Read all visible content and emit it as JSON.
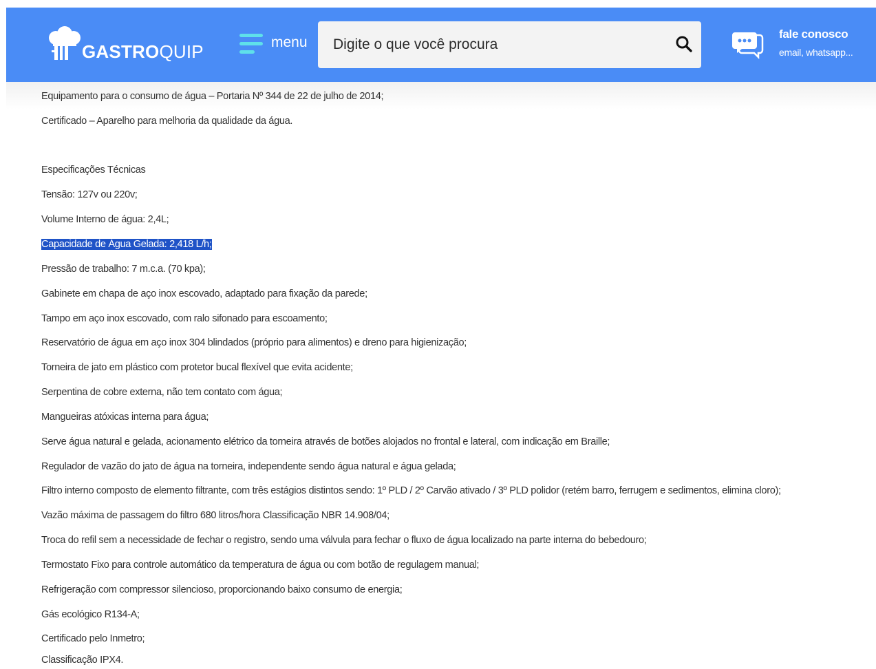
{
  "header": {
    "logo": {
      "bold": "GASTRO",
      "light": "QUIP"
    },
    "menu_label": "menu",
    "search": {
      "placeholder": "Digite o que você procura"
    },
    "contact": {
      "title": "fale conosco",
      "subtitle": "email, whatsapp..."
    }
  },
  "content": {
    "lines": [
      "Equipamento para o consumo de água – Portaria Nº 344 de 22 de julho de 2014;",
      "Certificado – Aparelho para melhoria da qualidade da água.",
      "",
      "Especificações Técnicas",
      "Tensão: 127v ou 220v;",
      "Volume Interno de água: 2,4L;",
      "Capacidade de Água Gelada: 2,418 L/h;",
      "Pressão de trabalho: 7 m.c.a. (70 kpa);",
      "Gabinete em chapa de aço inox escovado, adaptado para fixação da parede;",
      "Tampo em aço inox escovado, com ralo sifonado para escoamento;",
      "Reservatório de água em aço inox 304 blindados (próprio para alimentos) e dreno para higienização;",
      "Torneira de jato em plástico com protetor bucal flexível que evita acidente;",
      "Serpentina de cobre externa, não tem contato com água;",
      "Mangueiras atóxicas interna para água;",
      "Serve água natural e gelada, acionamento elétrico da torneira através de botões alojados no frontal e lateral, com indicação em Braille;",
      "Regulador de vazão do jato de água na torneira, independente sendo água natural e água gelada;",
      "Filtro interno composto de elemento filtrante, com três estágios distintos sendo: 1º PLD / 2º Carvão ativado / 3º PLD polidor (retém barro, ferrugem e sedimentos, elimina cloro);",
      "Vazão máxima de passagem do filtro 680 litros/hora Classificação NBR 14.908/04;",
      "Troca do refil sem a necessidade de fechar o registro, sendo uma válvula para fechar o fluxo de água localizado na parte interna do bebedouro;",
      "Termostato Fixo para controle automático da temperatura de água ou com botão de regulagem manual;",
      "Refrigeração com compressor silencioso, proporcionando baixo consumo de energia;",
      "Gás ecológico R134-A;",
      "Certificado pelo Inmetro;",
      "Classificação IPX4."
    ]
  },
  "colors": {
    "header_bg": "#4a8cf6",
    "hamburger": "#5fe0ea",
    "selection": "#1f53c7",
    "text": "#333333"
  },
  "icons": {
    "logo": "chef-hat-fork-knife-icon",
    "menu": "hamburger-icon",
    "search": "search-icon",
    "contact": "chat-bubble-icon"
  }
}
